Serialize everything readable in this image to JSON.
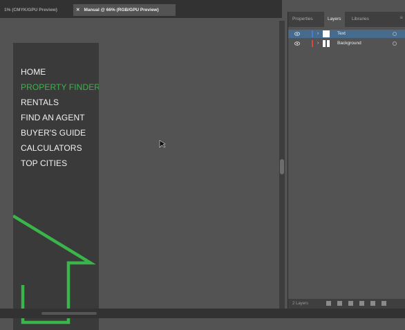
{
  "document_tabs": [
    {
      "label": "1% (CMYK/GPU Preview)",
      "active": false
    },
    {
      "close_glyph": "✕",
      "label": "Manual @ 66% (RGB/GPU Preview)",
      "active": true
    }
  ],
  "artboard": {
    "nav_items": [
      {
        "label": "HOME",
        "color": "#f2f2f2"
      },
      {
        "label": "PROPERTY FINDER",
        "color": "#39b54a"
      },
      {
        "label": "RENTALS",
        "color": "#f2f2f2"
      },
      {
        "label": "FIND AN AGENT",
        "color": "#f2f2f2"
      },
      {
        "label": "BUYER'S GUIDE",
        "color": "#f2f2f2"
      },
      {
        "label": "CALCULATORS",
        "color": "#f2f2f2"
      },
      {
        "label": "TOP CITIES",
        "color": "#f2f2f2"
      }
    ],
    "arrow_color": "#39b54a",
    "background_color": "#3a3a3a"
  },
  "panel": {
    "tabs": [
      {
        "label": "Properties",
        "active": false
      },
      {
        "label": "Layers",
        "active": true
      },
      {
        "label": "Libraries",
        "active": false
      }
    ],
    "menu_icon": "panel-menu-icon",
    "layers": [
      {
        "name": "Text",
        "color": "#4a7bd0",
        "thumbnail": "white-solid",
        "selected": true
      },
      {
        "name": "Background",
        "color": "#e0453a",
        "thumbnail": "white-split",
        "selected": false
      }
    ],
    "footer": {
      "count": "2 Layers",
      "icons": [
        "export-icon",
        "locate-icon",
        "make-clip-mask-icon",
        "new-sublayer-icon",
        "new-layer-icon",
        "delete-icon"
      ]
    }
  },
  "colors": {
    "canvas": "#535353",
    "selection": "#466b8d",
    "ui_dark": "#323232"
  }
}
